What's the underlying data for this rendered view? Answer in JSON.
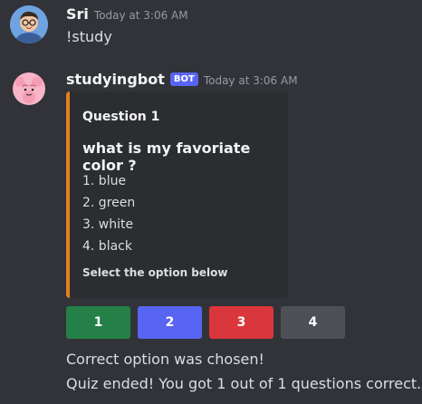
{
  "messages": [
    {
      "username": "Sri",
      "timestamp": "Today at 3:06 AM",
      "text": "!study",
      "avatar": "person-avatar-icon"
    },
    {
      "username": "studyingbot",
      "bot_tag": "BOT",
      "timestamp": "Today at 3:06 AM",
      "avatar": "brain-avatar-icon",
      "embed": {
        "accent_color": "#e67e22",
        "author": "Question 1",
        "title": "what is my favoriate color ?",
        "options": [
          "1. blue",
          "2. green",
          "3. white",
          "4. black"
        ],
        "footer": "Select the option below"
      },
      "buttons": [
        {
          "label": "1",
          "color": "#248046"
        },
        {
          "label": "2",
          "color": "#5865f2"
        },
        {
          "label": "3",
          "color": "#da373c"
        },
        {
          "label": "4",
          "color": "#4e5058"
        }
      ],
      "results": [
        "Correct option was chosen!",
        "Quiz ended! You got 1 out of 1 questions correct."
      ]
    }
  ]
}
